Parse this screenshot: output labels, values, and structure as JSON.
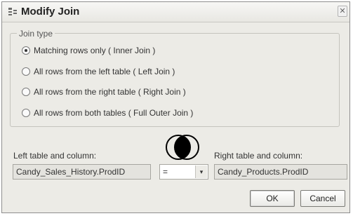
{
  "window": {
    "title": "Modify Join",
    "close_glyph": "✕",
    "icon": "join-properties-icon"
  },
  "join_type": {
    "legend": "Join type",
    "options": [
      {
        "label": "Matching rows only ( Inner Join )",
        "selected": true
      },
      {
        "label": "All rows from the left table ( Left Join )",
        "selected": false
      },
      {
        "label": "All rows from the right table ( Right Join )",
        "selected": false
      },
      {
        "label": "All rows from both tables ( Full Outer Join )",
        "selected": false
      }
    ]
  },
  "left": {
    "label": "Left table and column:",
    "value": "Candy_Sales_History.ProdID"
  },
  "operator": {
    "value": "=",
    "arrow": "▾"
  },
  "right": {
    "label": "Right table and column:",
    "value": "Candy_Products.ProdID"
  },
  "buttons": {
    "ok": "OK",
    "cancel": "Cancel"
  },
  "colors": {
    "dialog_bg": "#ecebe6",
    "venn_fill": "#000000"
  }
}
